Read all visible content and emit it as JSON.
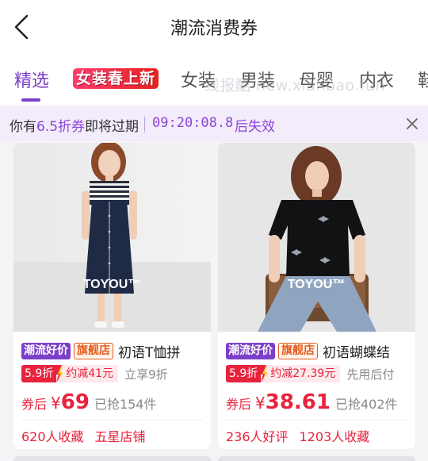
{
  "header": {
    "title": "潮流消费券"
  },
  "tabs": {
    "items": [
      "精选",
      "女装春上新",
      "女装",
      "男装",
      "母婴",
      "内衣",
      "鞋"
    ],
    "active": "精选"
  },
  "watermark": "线报酷 new.xianbao.fun",
  "notice": {
    "prefix": "你有",
    "highlight": "6.5折券",
    "suffix": "即将过期",
    "countdown": "09:20:08.8",
    "countdown_suffix": "后失效"
  },
  "colors": {
    "accent": "#7b3fc9",
    "price": "#e8233d",
    "notice_bg": "#f3ecfb"
  },
  "products": [
    {
      "badge": "潮流好价",
      "flag": "旗舰店",
      "title": "初语T恤拼",
      "discount": "5.9折",
      "save": "约减41元",
      "extra": "立享9折",
      "price_label": "券后",
      "currency": "¥",
      "price": "69",
      "sold": "已抢154件",
      "meta": [
        "620人收藏",
        "五星店铺"
      ],
      "brand_mark": "TOYOU™"
    },
    {
      "badge": "潮流好价",
      "flag": "旗舰店",
      "title": "初语蝴蝶结",
      "discount": "5.9折",
      "save": "约减27.39元",
      "extra": "先用后付",
      "price_label": "券后",
      "currency": "¥",
      "price": "38.61",
      "sold": "已抢402件",
      "meta": [
        "236人好评",
        "1203人收藏"
      ],
      "brand_mark": "TOYOU™"
    }
  ]
}
